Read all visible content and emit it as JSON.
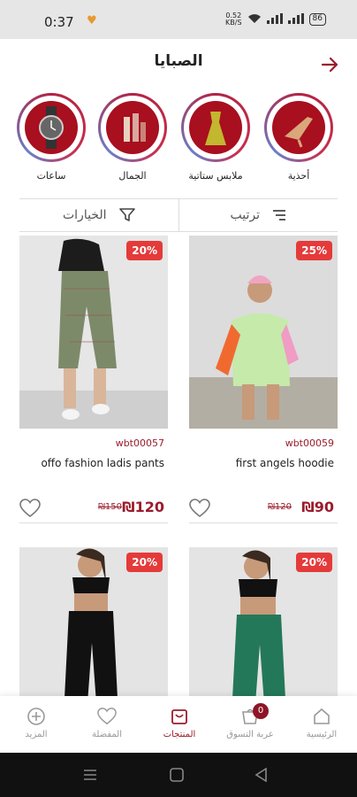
{
  "status": {
    "time": "0:37",
    "speed_top": "0.52",
    "speed_bottom": "KB/S",
    "battery": "86"
  },
  "header": {
    "title": "الصبايا"
  },
  "categories": [
    {
      "label": "أحذية",
      "icon": "heel-shoe-icon"
    },
    {
      "label": "ملابس ستاتية",
      "icon": "dress-icon"
    },
    {
      "label": "الجمال",
      "icon": "cosmetics-icon"
    },
    {
      "label": "ساعات",
      "icon": "watch-icon"
    }
  ],
  "filters": {
    "sort": "ترتيب",
    "options": "الخيارات"
  },
  "products": [
    {
      "badge": "25%",
      "code": "wbt00059",
      "name": "first angels hoodie",
      "price": "₪90",
      "old_price": "₪120"
    },
    {
      "badge": "20%",
      "code": "wbt00057",
      "name": "offo fashion ladis pants",
      "price": "₪120",
      "old_price": "₪150"
    },
    {
      "badge": "20%"
    },
    {
      "badge": "20%"
    }
  ],
  "nav": {
    "home": "الرئيسية",
    "cart": "عربة التسوق",
    "cart_count": "0",
    "products": "المنتجات",
    "favorites": "المفضلة",
    "more": "المزيد"
  },
  "colors": {
    "brand": "#9a1c2c",
    "badge": "#e53a3a"
  }
}
